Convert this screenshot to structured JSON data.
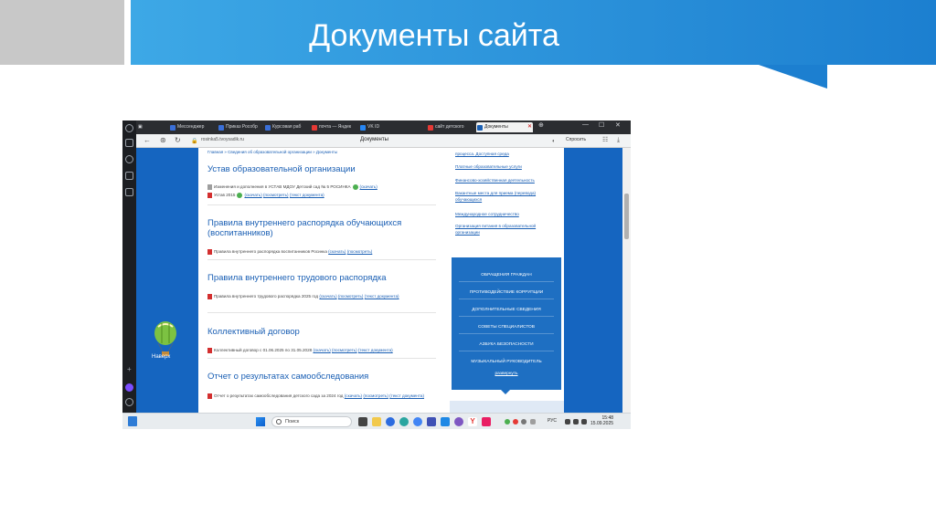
{
  "slide": {
    "title": "Документы сайта",
    "colors": {
      "header_start": "#3da8e6",
      "header_end": "#1c7fd0",
      "side_tab": "#c8c8c8"
    }
  },
  "browser": {
    "tabs": [
      {
        "label": "Мессенджер",
        "icon": "messenger-icon"
      },
      {
        "label": "Приказ Рособр",
        "icon": "mail-icon"
      },
      {
        "label": "Курсовая раб",
        "icon": "mail-icon"
      },
      {
        "label": "почта — Яндек",
        "icon": "yandex-mail-icon"
      },
      {
        "label": "VK ID",
        "icon": "vk-icon"
      },
      {
        "label": "сайт детского",
        "icon": "yandex-icon"
      },
      {
        "label": "Документы",
        "icon": "site-icon",
        "active": true
      }
    ],
    "url": "rosinka5.tvoysadik.ru",
    "page_title": "Документы",
    "ask_label": "Спросить"
  },
  "page": {
    "breadcrumb": "Главная » Сведения об образовательной организации » Документы",
    "scroll_top_label": "Наверх",
    "sections": [
      {
        "title": "Устав образовательной организации",
        "lines": [
          {
            "text": "Изменения и дополнения в УСТАВ МДОУ Детский сад № 5 РОСИНКА",
            "links": [
              "(скачать)"
            ]
          },
          {
            "text": "Устав 2015",
            "links": [
              "(скачать)",
              "(посмотреть)",
              "(текст документа)"
            ]
          }
        ]
      },
      {
        "title": "Правила внутреннего распорядка обучающихся (воспитанников)",
        "lines": [
          {
            "text": "Правила внутреннего распорядка воспитанников Росинка",
            "links": [
              "(скачать)",
              "(посмотреть)"
            ]
          }
        ]
      },
      {
        "title": "Правила внутреннего трудового распорядка",
        "lines": [
          {
            "text": "Правила внутреннего трудового распорядка 2025 год",
            "links": [
              "(скачать)",
              "(посмотреть)",
              "(текст документа)"
            ]
          }
        ]
      },
      {
        "title": "Коллективный договор",
        "lines": [
          {
            "text": "Коллективный договор с 01.06.2025 по 31.05.2028",
            "links": [
              "(скачать)",
              "(посмотреть)",
              "(текст документа)"
            ]
          }
        ]
      },
      {
        "title": "Отчет о результатах самообследования",
        "lines": [
          {
            "text": "Отчет о результатах самообследования детского сада за 2024 год",
            "links": [
              "(скачать)",
              "(посмотреть)",
              "(текст документа)"
            ]
          }
        ]
      }
    ],
    "right_links": [
      "процесса. Доступная среда",
      "Платные образовательные услуги",
      "Финансово-хозяйственная деятельность",
      "Вакантные места для приема (перевода) обучающихся",
      "Международное сотрудничество",
      "Организация питания в образовательной организации"
    ],
    "blue_menu": [
      "ОБРАЩЕНИЯ ГРАЖДАН",
      "ПРОТИВОДЕЙСТВИЕ КОРРУПЦИИ",
      "ДОПОЛНИТЕЛЬНЫЕ СВЕДЕНИЯ",
      "СОВЕТЫ СПЕЦИАЛИСТОВ",
      "АЗБУКА БЕЗОПАСНОСТИ",
      "МУЗЫКАЛЬНЫЙ РУКОВОДИТЕЛЬ"
    ],
    "menu_expand": "развернуть"
  },
  "taskbar": {
    "search_label": "Поиск",
    "lang": "РУС",
    "time": "15:48",
    "date": "15.09.2025"
  }
}
